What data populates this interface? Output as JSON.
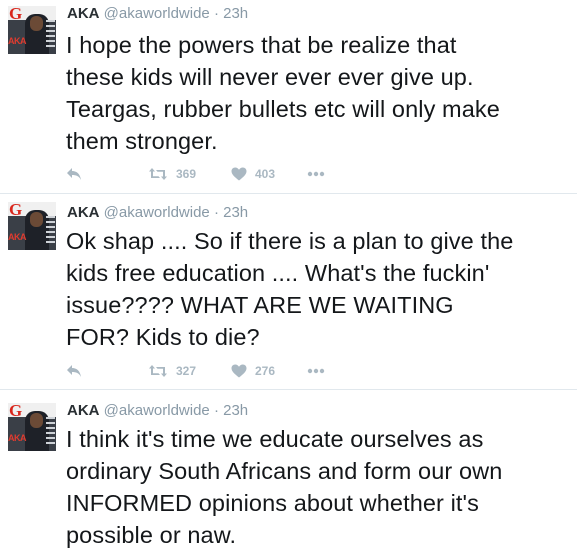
{
  "tweets": [
    {
      "name": "AKA",
      "handle": "@akaworldwide",
      "separator": "·",
      "time": "23h",
      "lines": [
        "I hope the powers that be realize that",
        "these kids will never ever ever give up.",
        "Teargas, rubber bullets etc will only make",
        "them stronger."
      ],
      "retweets": "369",
      "likes": "403"
    },
    {
      "name": "AKA",
      "handle": "@akaworldwide",
      "separator": "·",
      "time": "23h",
      "lines": [
        "Ok shap .... So if there is a plan to give the",
        "kids free education .... What's the fuckin'",
        "issue???? WHAT ARE WE WAITING",
        "FOR? Kids to die?"
      ],
      "retweets": "327",
      "likes": "276"
    },
    {
      "name": "AKA",
      "handle": "@akaworldwide",
      "separator": "·",
      "time": "23h",
      "lines": [
        "I think it's time we educate ourselves as",
        "ordinary South Africans and form our own",
        "INFORMED opinions about whether it's",
        "possible or naw."
      ]
    }
  ],
  "avatar_text": {
    "magazine_letter": "G",
    "cover_text": "AKA"
  },
  "icons": {
    "reply": "reply-icon",
    "retweet": "retweet-icon",
    "like": "heart-icon",
    "more": "more-dots-icon"
  },
  "colors": {
    "text": "#14171a",
    "name": "#292f33",
    "muted": "#8899a6",
    "action": "#aab8c2",
    "divider": "#e1e8ed"
  }
}
